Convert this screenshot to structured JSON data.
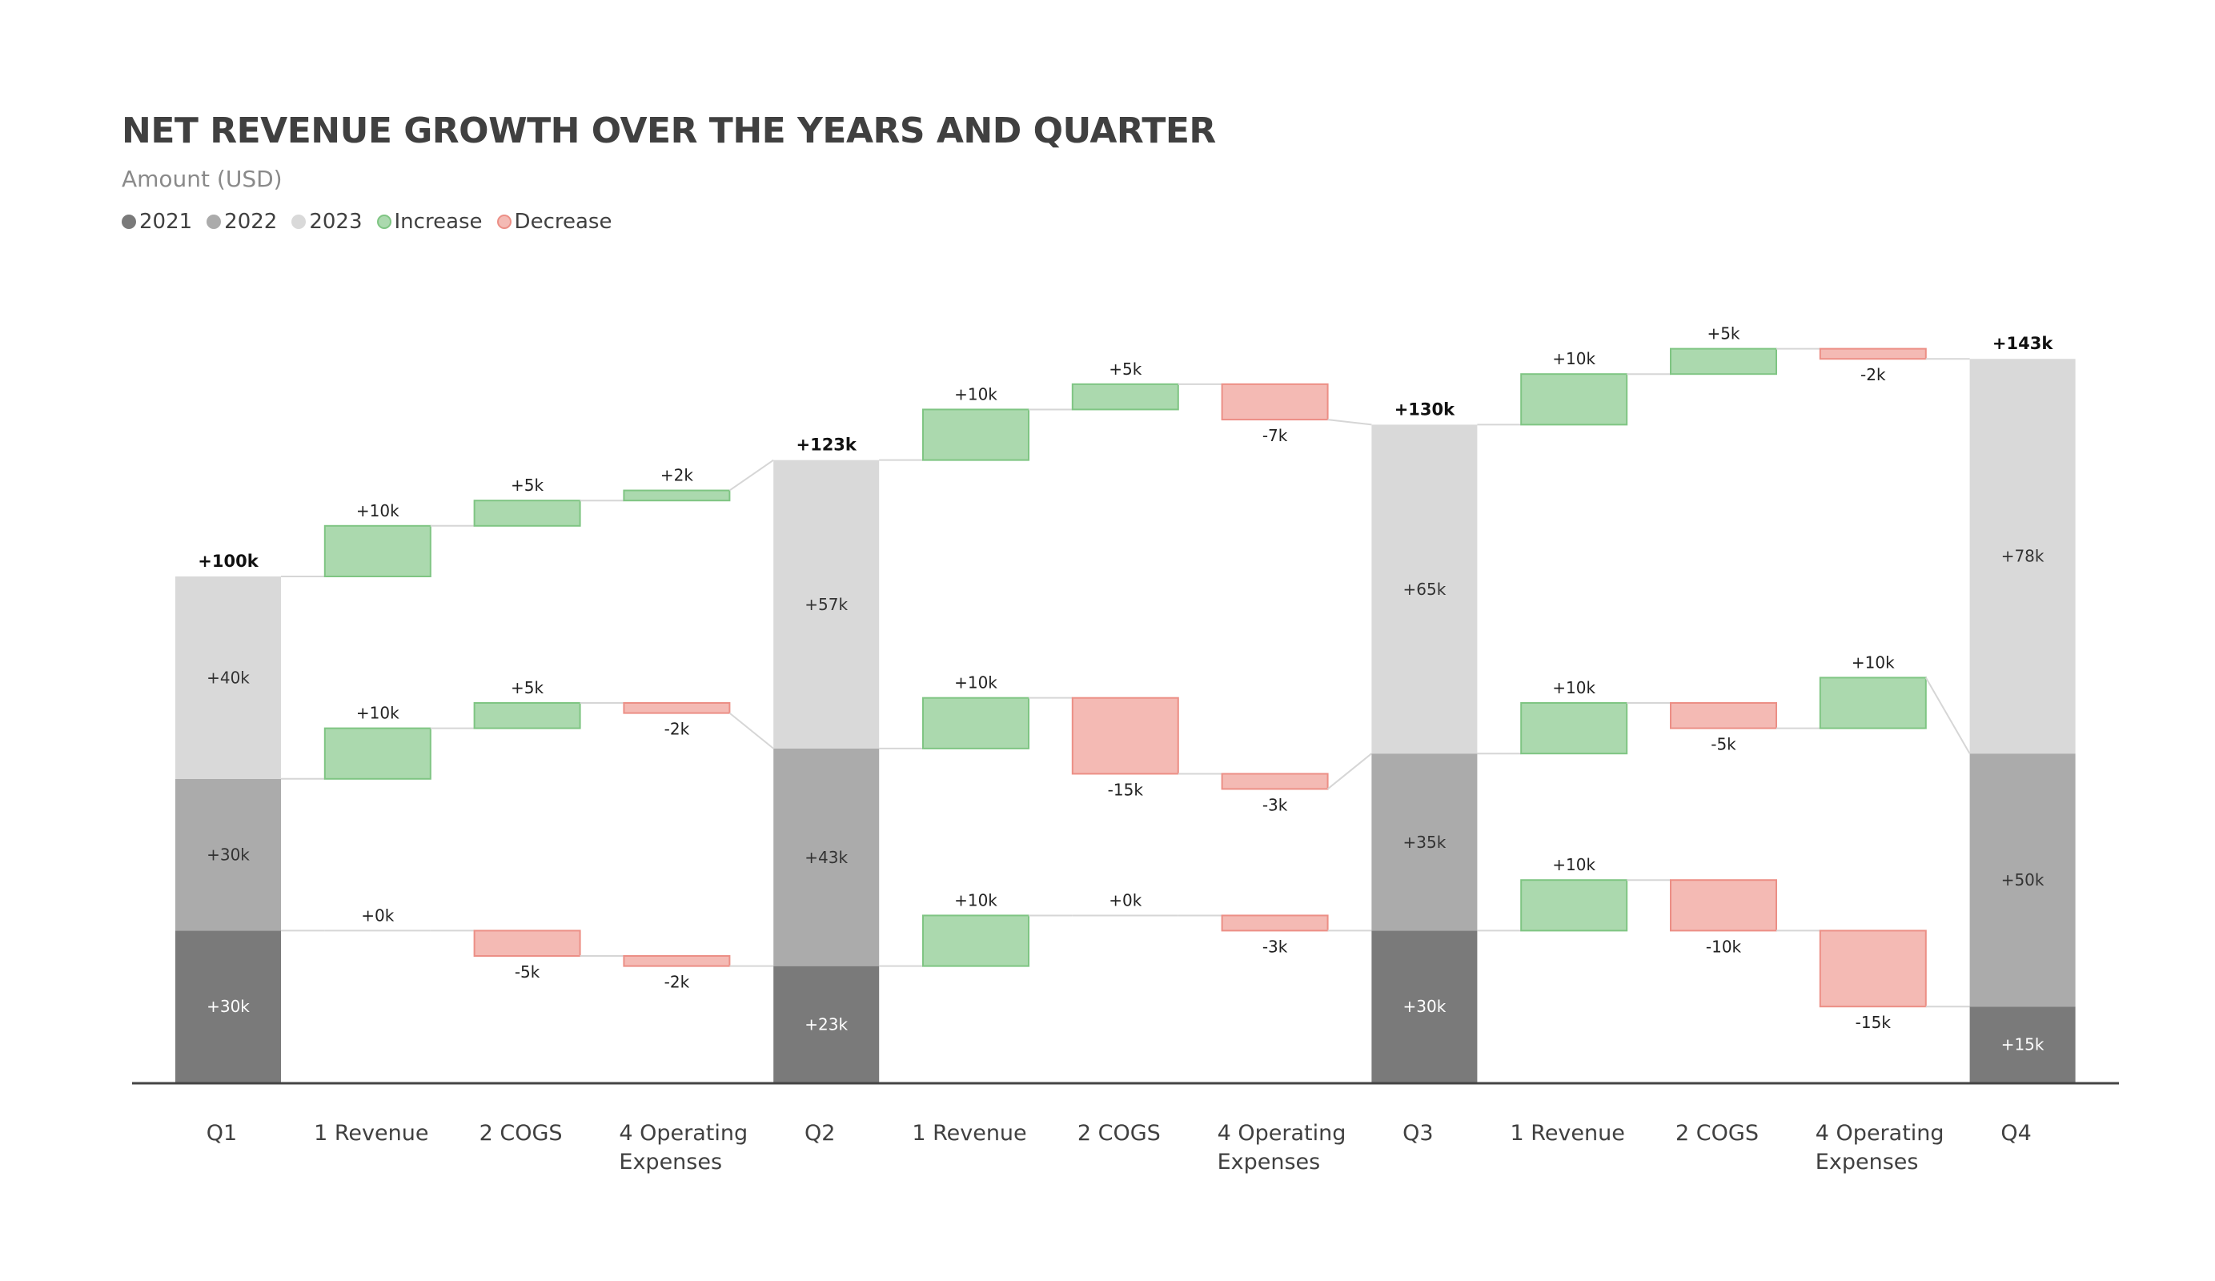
{
  "chart_data": {
    "type": "waterfall-stacked",
    "title": "NET REVENUE GROWTH OVER THE YEARS AND QUARTER",
    "subtitle": "Amount (USD)",
    "legend": [
      {
        "label": "2021",
        "color": "#7a7a7a"
      },
      {
        "label": "2022",
        "color": "#ababab"
      },
      {
        "label": "2023",
        "color": "#d9d9d9"
      },
      {
        "label": "Increase",
        "color": "#abd9ae",
        "border": "#7fc583"
      },
      {
        "label": "Decrease",
        "color": "#f4bab4",
        "border": "#ec8f86"
      }
    ],
    "legend_position": "top-left",
    "categories": [
      "Q1",
      "1 Revenue",
      "2 COGS",
      "4 Operating Expenses",
      "Q2",
      "1 Revenue",
      "2 COGS",
      "4 Operating Expenses",
      "Q3",
      "1 Revenue",
      "2 COGS",
      "4 Operating Expenses",
      "Q4"
    ],
    "category_type": [
      "total",
      "delta",
      "delta",
      "delta",
      "total",
      "delta",
      "delta",
      "delta",
      "total",
      "delta",
      "delta",
      "delta",
      "total"
    ],
    "series": [
      {
        "name": "2021",
        "values": [
          30,
          0,
          -5,
          -2,
          23,
          10,
          0,
          -3,
          30,
          10,
          -10,
          -15,
          15
        ]
      },
      {
        "name": "2022",
        "values": [
          30,
          10,
          5,
          -2,
          43,
          10,
          -15,
          -3,
          35,
          10,
          -5,
          10,
          50
        ]
      },
      {
        "name": "2023",
        "values": [
          40,
          10,
          5,
          2,
          57,
          10,
          5,
          -7,
          65,
          10,
          5,
          -2,
          78
        ]
      }
    ],
    "totals": [
      100,
      123,
      130,
      143
    ],
    "unit_suffix": "k",
    "ylim": [
      0,
      150
    ],
    "grid": false
  }
}
